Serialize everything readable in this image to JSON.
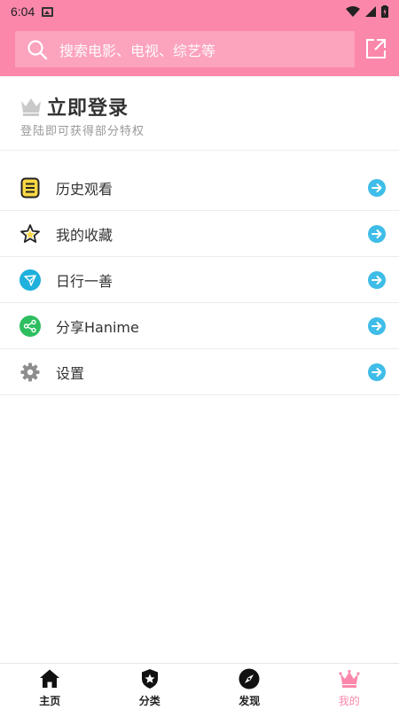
{
  "status_bar": {
    "time": "6:04"
  },
  "search": {
    "placeholder": "搜索电影、电视、综艺等"
  },
  "login": {
    "title": "立即登录",
    "subtitle": "登陆即可获得部分特权"
  },
  "menu": {
    "items": [
      {
        "label": "历史观看",
        "icon": "history-icon"
      },
      {
        "label": "我的收藏",
        "icon": "star-icon"
      },
      {
        "label": "日行一善",
        "icon": "paper-plane-icon"
      },
      {
        "label": "分享Hanime",
        "icon": "share-icon"
      },
      {
        "label": "设置",
        "icon": "gear-icon"
      }
    ]
  },
  "bottom_nav": {
    "items": [
      {
        "label": "主页",
        "icon": "home-icon",
        "active": false
      },
      {
        "label": "分类",
        "icon": "category-shield-icon",
        "active": false
      },
      {
        "label": "发现",
        "icon": "compass-icon",
        "active": false
      },
      {
        "label": "我的",
        "icon": "crown-icon",
        "active": true
      }
    ]
  },
  "colors": {
    "accent": "#fb88ab",
    "search_box": "#fca3be",
    "arrow": "#3fbde8",
    "share_green": "#2dbe60",
    "plane_blue": "#1fb0dc"
  }
}
